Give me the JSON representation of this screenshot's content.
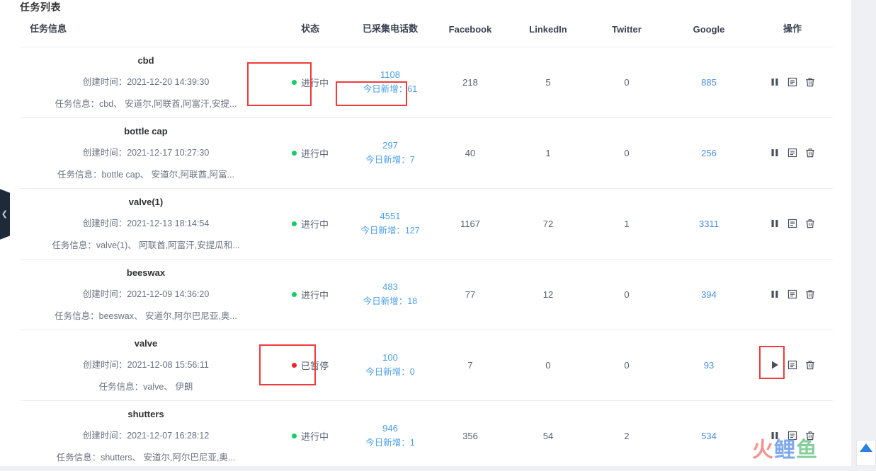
{
  "panel": {
    "title": "任务列表"
  },
  "left_rail": {
    "collapse_icon": "chevron-left-icon"
  },
  "table": {
    "columns": [
      {
        "key": "info",
        "label": "任务信息"
      },
      {
        "key": "status",
        "label": "状态"
      },
      {
        "key": "phone",
        "label": "已采集电话数"
      },
      {
        "key": "facebook",
        "label": "Facebook"
      },
      {
        "key": "linkedin",
        "label": "LinkedIn"
      },
      {
        "key": "twitter",
        "label": "Twitter"
      },
      {
        "key": "google",
        "label": "Google"
      },
      {
        "key": "operation",
        "label": "操作"
      }
    ],
    "labels": {
      "create_time_prefix": "创建时间：",
      "task_info_prefix": "任务信息：",
      "today_added_prefix": "今日新增："
    },
    "rows": [
      {
        "name": "cbd",
        "create_time": "创建时间：2021-12-20 14:39:30",
        "task_info": "任务信息：cbd、 安道尔,阿联酋,阿富汗,安提...",
        "status": "进行中",
        "status_kind": "running",
        "phone_total": "1108",
        "phone_today": "今日新增：61",
        "facebook": "218",
        "linkedin": "5",
        "twitter": "0",
        "google": "885",
        "op_primary": "pause-icon",
        "ops": [
          "pause-icon",
          "report-icon",
          "delete-icon"
        ]
      },
      {
        "name": "bottle cap",
        "create_time": "创建时间：2021-12-17 10:27:30",
        "task_info": "任务信息：bottle cap、 安道尔,阿联酋,阿富...",
        "status": "进行中",
        "status_kind": "running",
        "phone_total": "297",
        "phone_today": "今日新增：7",
        "facebook": "40",
        "linkedin": "1",
        "twitter": "0",
        "google": "256",
        "op_primary": "pause-icon",
        "ops": [
          "pause-icon",
          "report-icon",
          "delete-icon"
        ]
      },
      {
        "name": "valve(1)",
        "create_time": "创建时间：2021-12-13 18:14:54",
        "task_info": "任务信息：valve(1)、 阿联酋,阿富汗,安提瓜和...",
        "status": "进行中",
        "status_kind": "running",
        "phone_total": "4551",
        "phone_today": "今日新增：127",
        "facebook": "1167",
        "linkedin": "72",
        "twitter": "1",
        "google": "3311",
        "op_primary": "pause-icon",
        "ops": [
          "pause-icon",
          "report-icon",
          "delete-icon"
        ]
      },
      {
        "name": "beeswax",
        "create_time": "创建时间：2021-12-09 14:36:20",
        "task_info": "任务信息：beeswax、 安道尔,阿尔巴尼亚,奥...",
        "status": "进行中",
        "status_kind": "running",
        "phone_total": "483",
        "phone_today": "今日新增：18",
        "facebook": "77",
        "linkedin": "12",
        "twitter": "0",
        "google": "394",
        "op_primary": "pause-icon",
        "ops": [
          "pause-icon",
          "report-icon",
          "delete-icon"
        ]
      },
      {
        "name": "valve",
        "create_time": "创建时间：2021-12-08 15:56:11",
        "task_info": "任务信息：valve、 伊朗",
        "status": "已暂停",
        "status_kind": "paused",
        "phone_total": "100",
        "phone_today": "今日新增：0",
        "facebook": "7",
        "linkedin": "0",
        "twitter": "0",
        "google": "93",
        "op_primary": "play-icon",
        "ops": [
          "play-icon",
          "report-icon",
          "delete-icon"
        ]
      },
      {
        "name": "shutters",
        "create_time": "创建时间：2021-12-07 16:28:12",
        "task_info": "任务信息：shutters、 安道尔,阿尔巴尼亚,奥...",
        "status": "进行中",
        "status_kind": "running",
        "phone_total": "946",
        "phone_today": "今日新增：1",
        "facebook": "356",
        "linkedin": "54",
        "twitter": "2",
        "google": "534",
        "op_primary": "pause-icon",
        "ops": [
          "pause-icon",
          "report-icon",
          "delete-icon"
        ]
      }
    ]
  },
  "annotations": {
    "boxes": [
      {
        "target": "status-cbd",
        "color": "#ef3b3b"
      },
      {
        "target": "phone-today-cbd",
        "color": "#ef3b3b"
      },
      {
        "target": "status-valve",
        "color": "#ef3b3b"
      },
      {
        "target": "play-valve",
        "color": "#ef3b3b"
      }
    ]
  },
  "watermark": {
    "char1": "火",
    "char2": "鲤",
    "char3": "鱼",
    "color1": "#f5938f",
    "color2": "#7fa9ec",
    "color3": "#86cf9c"
  },
  "back_to_top": {
    "icon": "triangle-up-icon",
    "color": "#2a7fe0"
  },
  "colors": {
    "link_blue": "#4a90e2",
    "status_running": "#13ce66",
    "status_paused": "#f5222d",
    "annotation_red": "#ef3b3b"
  }
}
